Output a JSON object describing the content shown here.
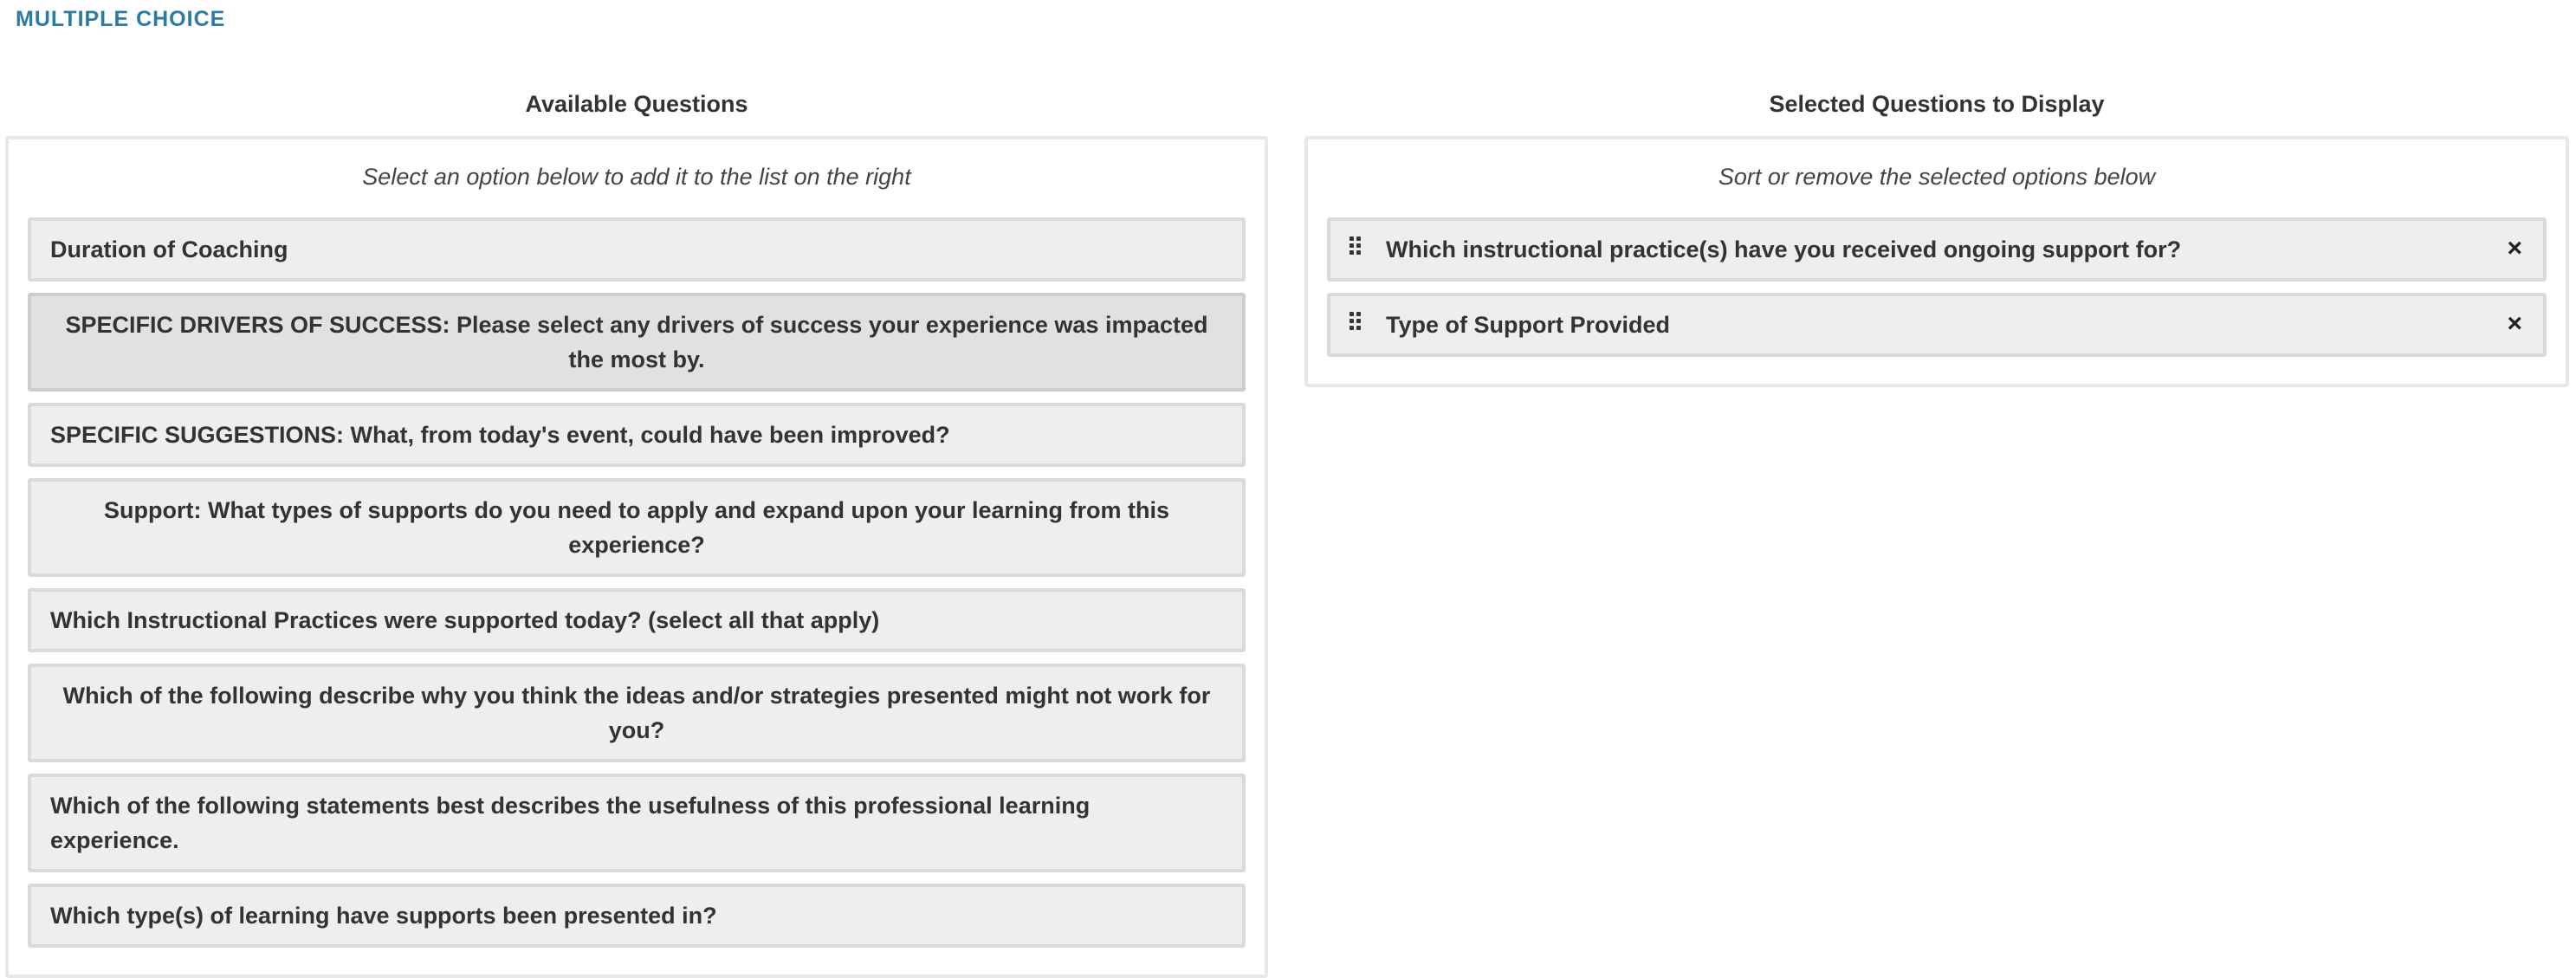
{
  "section_title": "MULTIPLE CHOICE",
  "available": {
    "heading": "Available Questions",
    "hint": "Select an option below to add it to the list on the right",
    "items": [
      {
        "label": "Duration of Coaching"
      },
      {
        "label": "SPECIFIC DRIVERS OF SUCCESS: Please select any drivers of success your experience was impacted the most by."
      },
      {
        "label": "SPECIFIC SUGGESTIONS: What, from today's event, could have been improved?"
      },
      {
        "label": "Support: What types of supports do you need to apply and expand upon your learning from this experience?"
      },
      {
        "label": "Which Instructional Practices were supported today? (select all that apply)"
      },
      {
        "label": "Which of the following describe why you think the ideas and/or strategies presented might not work for you?"
      },
      {
        "label": "Which of the following statements best describes the usefulness of this professional learning experience."
      },
      {
        "label": "Which type(s) of learning have supports been presented in?"
      }
    ]
  },
  "selected": {
    "heading": "Selected Questions to Display",
    "hint": "Sort or remove the selected options below",
    "remove_label": "×",
    "items": [
      {
        "label": "Which instructional practice(s) have you received ongoing support for?"
      },
      {
        "label": "Type of Support Provided"
      }
    ]
  },
  "colors": {
    "accent": "#2b7ba3",
    "item_bg": "#eeeeee",
    "item_hover_bg": "#e1e1e1"
  }
}
